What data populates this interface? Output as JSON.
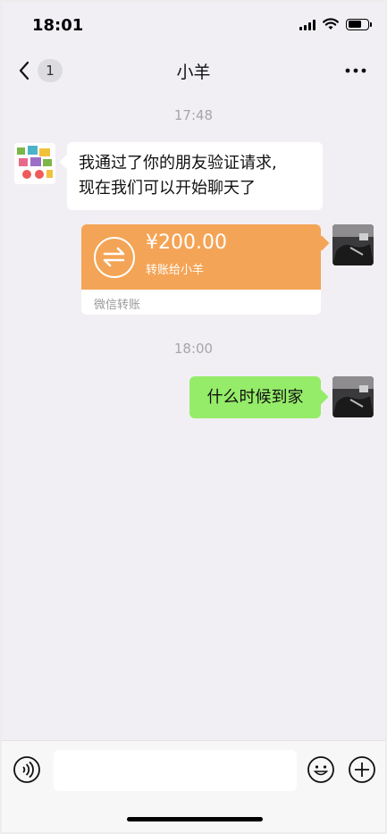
{
  "status_bar": {
    "time": "18:01",
    "battery_percent": 70
  },
  "nav": {
    "back_badge": "1",
    "title": "小羊"
  },
  "messages": {
    "time_1": "17:48",
    "incoming_text_line1": "我通过了你的朋友验证请求,",
    "incoming_text_line2": "现在我们可以开始聊天了",
    "transfer": {
      "amount": "¥200.00",
      "note": "转账给小羊",
      "footer": "微信转账",
      "color": "#f4a456"
    },
    "time_2": "18:00",
    "outgoing_text": "什么时候到家"
  },
  "input_bar": {
    "placeholder": ""
  },
  "colors": {
    "outgoing_bubble": "#95ec69",
    "background": "#f1eff4"
  }
}
